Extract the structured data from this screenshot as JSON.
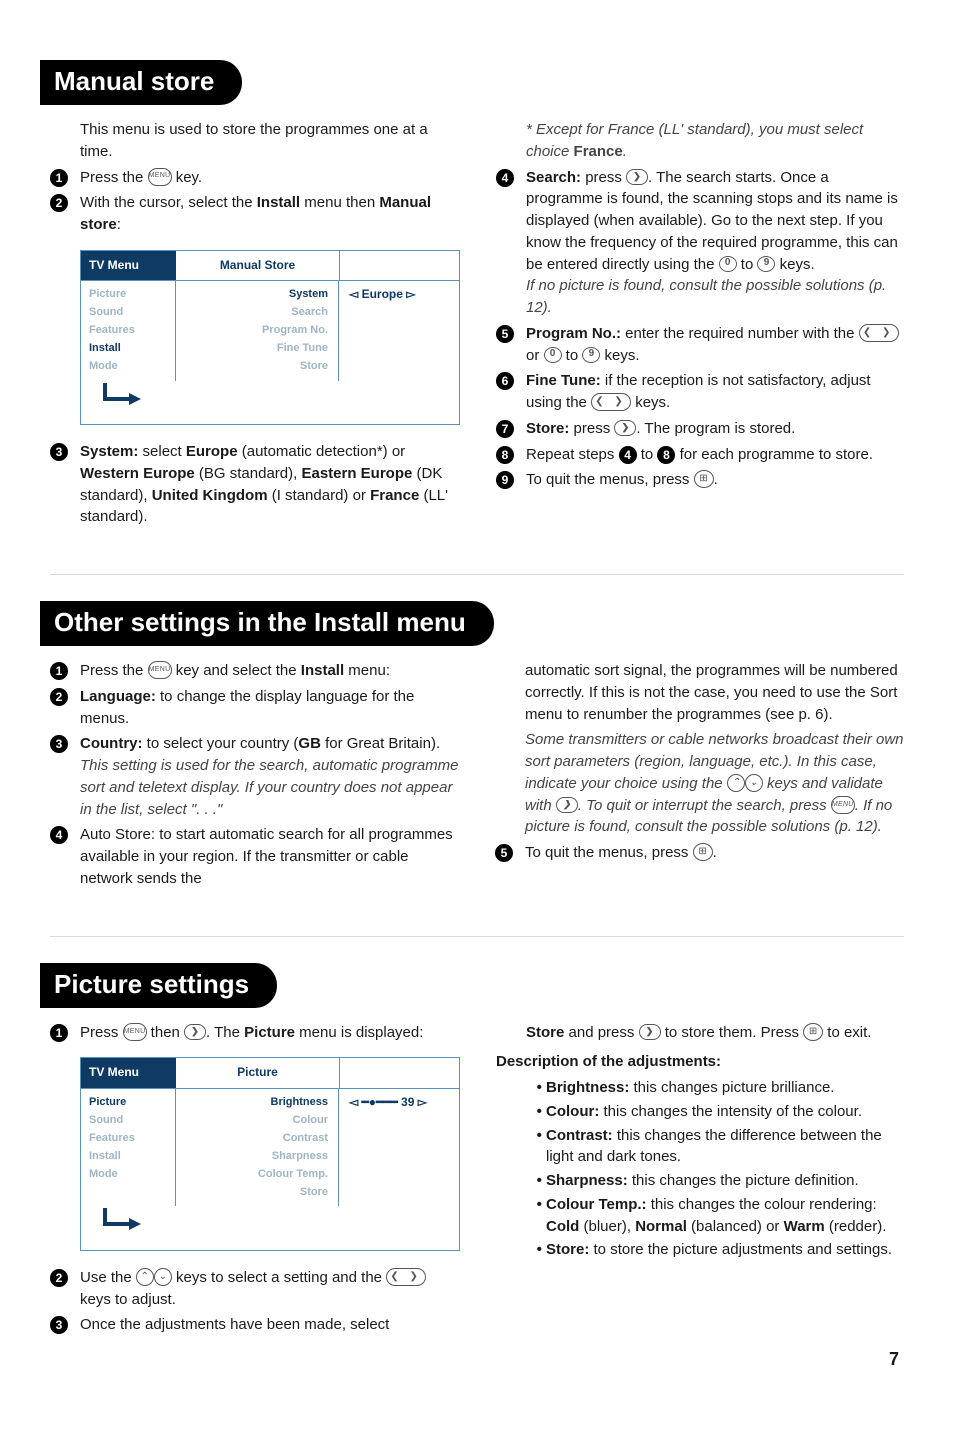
{
  "page_number": "7",
  "sections": {
    "manual_store": {
      "title": "Manual store",
      "intro": "This menu is used to store the programmes one at a time.",
      "step1": "Press the ",
      "step1b": " key.",
      "step2a": "With the cursor, select the ",
      "step2_bold1": "Install",
      "step2b": " menu then ",
      "step2_bold2": "Manual store",
      "step2c": ":",
      "step3_bold": "System:",
      "step3a": " select ",
      "step3_b1": "Europe",
      "step3b": " (automatic detection*) or ",
      "step3_b2": "Western Europe",
      "step3c": " (BG standard), ",
      "step3_b3": "Eastern Europe",
      "step3d": " (DK standard), ",
      "step3_b4": "United Kingdom",
      "step3e": " (I standard) or ",
      "step3_b5": "France",
      "step3f": " (LL' standard).",
      "note_star": "* ",
      "note_ital": "Except for France (LL' standard), you must select choice ",
      "note_bold": "France",
      "note_dot": ".",
      "step4_b": "Search:",
      "step4a": " press ",
      "step4b": ". The search starts. Once a programme is found, the scanning stops and its name is displayed (when available). Go to the next step. If you know the frequency of the required programme, this can be entered directly using the ",
      "step4c": " to ",
      "step4d": " keys.",
      "step4_ital": "If no picture is found, consult the possible solutions (p. 12).",
      "step5_b": "Program No.:",
      "step5a": " enter the required number with the ",
      "step5b": " or ",
      "step5c": " to ",
      "step5d": " keys.",
      "step6_b": "Fine Tune:",
      "step6a": " if the reception is not satisfactory, adjust using the ",
      "step6b": " keys.",
      "step7_b": "Store:",
      "step7a": " press ",
      "step7b": ". The program is stored.",
      "step8a": "Repeat steps ",
      "step8b": " to ",
      "step8c": " for each programme to store.",
      "step9a": "To quit the menus, press ",
      "step9b": ".",
      "osd": {
        "tv_menu": "TV Menu",
        "title": "Manual Store",
        "left": [
          "Picture",
          "Sound",
          "Features",
          "Install",
          "Mode"
        ],
        "left_active": "Install",
        "mid": [
          "System",
          "Search",
          "Program No.",
          "Fine Tune",
          "Store"
        ],
        "mid_active": "System",
        "val": "Europe"
      }
    },
    "other": {
      "title": "Other settings in the Install menu",
      "step1a": "Press the ",
      "step1b": " key and select the ",
      "step1_bold": "Install",
      "step1c": " menu:",
      "step2_b": "Language:",
      "step2a": " to change the display language for the menus.",
      "step3_b": "Country:",
      "step3a": " to select your country (",
      "step3_bold": "GB",
      "step3b": " for Great Britain).",
      "step3_ital": "This setting is used for the search, automatic programme sort and teletext display. If your country does not appear in the list, select \". . .\"",
      "step4a": "Auto Store: to start automatic search for all programmes available in your region. If the transmitter or cable network sends the",
      "right_para": "automatic sort signal, the programmes will be numbered correctly. If this is not the case, you need to use the Sort menu to renumber the programmes (see p. 6).",
      "right_ital1": "Some transmitters or cable networks broadcast their own sort parameters (region, language, etc.). In this case, indicate your choice using the ",
      "right_ital2": " keys and validate with ",
      "right_ital3": ". To quit or interrupt the search, press ",
      "right_ital4": ". If no picture is found, consult the possible solutions (p. 12).",
      "step5a": "To quit the menus, press ",
      "step5b": "."
    },
    "picture": {
      "title": "Picture settings",
      "step1a": "Press ",
      "step1b": " then ",
      "step1c": ". The ",
      "step1_bold": "Picture",
      "step1d": " menu is displayed:",
      "step2a": "Use the ",
      "step2b": " keys to select a setting and the ",
      "step2c": " keys to adjust.",
      "step3": "Once the adjustments have been made, select",
      "right1_b": "Store",
      "right1a": " and press ",
      "right1b": " to store them. Press ",
      "right1c": " to exit.",
      "desc_title": "Description of the adjustments:",
      "adj": {
        "brightness_b": "Brightness:",
        "brightness": " this changes picture brilliance.",
        "colour_b": "Colour:",
        "colour": " this changes the intensity of the colour.",
        "contrast_b": "Contrast:",
        "contrast": " this changes the difference between the light and dark tones.",
        "sharp_b": "Sharpness:",
        "sharp": " this changes the picture definition.",
        "temp_b": "Colour Temp.:",
        "temp1": " this changes the colour rendering: ",
        "temp_cold": "Cold",
        "temp2": " (bluer), ",
        "temp_norm": "Normal",
        "temp3": " (balanced) or ",
        "temp_warm": "Warm",
        "temp4": " (redder).",
        "store_b": "Store:",
        "store": " to store the picture adjustments and settings."
      },
      "osd": {
        "tv_menu": "TV Menu",
        "title": "Picture",
        "left": [
          "Picture",
          "Sound",
          "Features",
          "Install",
          "Mode"
        ],
        "left_active": "Picture",
        "mid": [
          "Brightness",
          "Colour",
          "Contrast",
          "Sharpness",
          "Colour Temp.",
          "Store"
        ],
        "mid_active": "Brightness",
        "val": "39"
      }
    }
  },
  "keys": {
    "menu": "MENU",
    "zero": "0",
    "nine": "9",
    "right": "❯",
    "leftright": "❮  ❯",
    "up": "⌃",
    "down": "⌄",
    "exit": "⊞"
  }
}
